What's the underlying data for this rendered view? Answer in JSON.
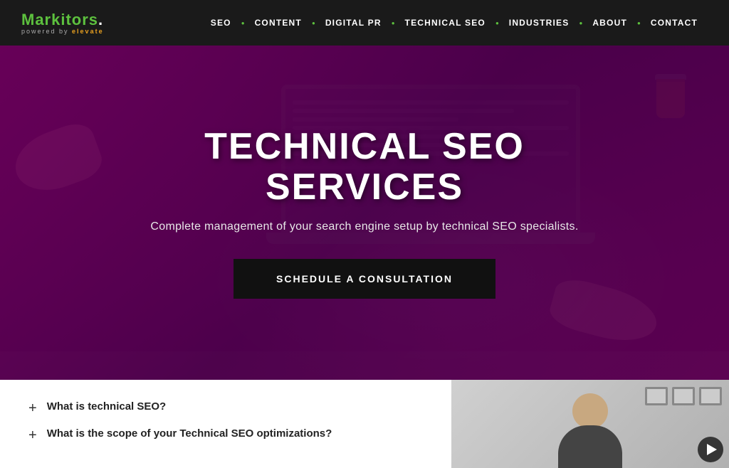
{
  "brand": {
    "name_green": "Markitors",
    "name_dot": ".",
    "sub_label": "powered by",
    "sub_brand": "elevate"
  },
  "nav": {
    "items": [
      {
        "label": "SEO",
        "id": "nav-seo"
      },
      {
        "label": "CONTENT",
        "id": "nav-content"
      },
      {
        "label": "DIGITAL PR",
        "id": "nav-digital-pr"
      },
      {
        "label": "TECHNICAL SEO",
        "id": "nav-technical-seo"
      },
      {
        "label": "INDUSTRIES",
        "id": "nav-industries"
      },
      {
        "label": "ABOUT",
        "id": "nav-about"
      },
      {
        "label": "CONTACT",
        "id": "nav-contact"
      }
    ]
  },
  "hero": {
    "title": "TECHNICAL SEO SERVICES",
    "subtitle": "Complete management of your search engine setup by technical SEO specialists.",
    "cta_label": "SCHEDULE A CONSULTATION"
  },
  "faq": {
    "items": [
      {
        "question": "What is technical SEO?",
        "plus": "+"
      },
      {
        "question": "What is the scope of your Technical SEO optimizations?",
        "plus": "+"
      }
    ]
  },
  "video": {
    "aria_label": "Video thumbnail - person speaking"
  }
}
